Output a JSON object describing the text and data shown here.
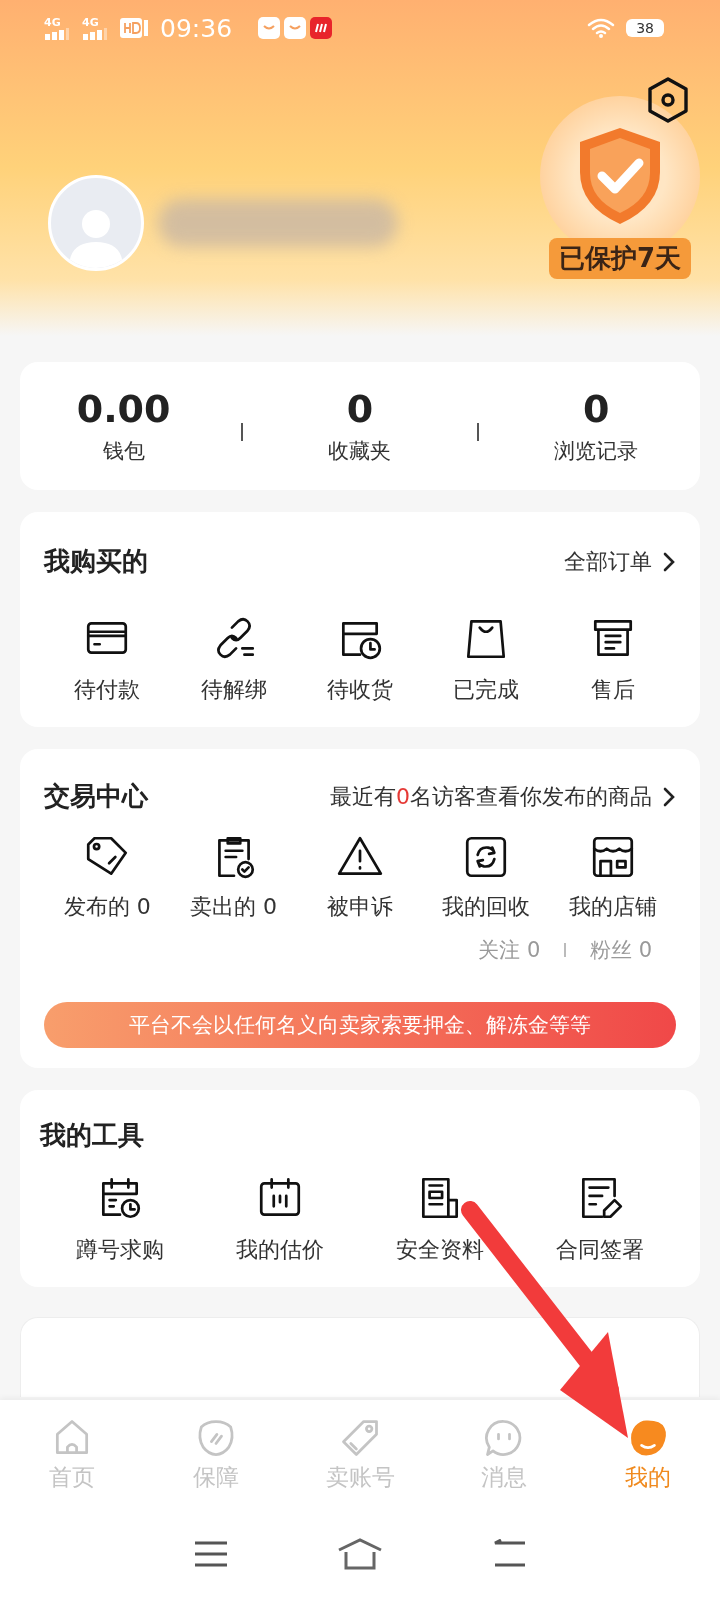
{
  "status_bar": {
    "signals": [
      "4G",
      "4G"
    ],
    "time": "09:36",
    "battery": "38"
  },
  "profile": {
    "protection_badge": "已保护7天"
  },
  "stats": [
    {
      "value": "0.00",
      "label": "钱包"
    },
    {
      "value": "0",
      "label": "收藏夹"
    },
    {
      "value": "0",
      "label": "浏览记录"
    }
  ],
  "purchases": {
    "title": "我购买的",
    "link": "全部订单",
    "items": [
      "待付款",
      "待解绑",
      "待收货",
      "已完成",
      "售后"
    ]
  },
  "trading": {
    "title": "交易中心",
    "notice_before": "最近有",
    "notice_count": "0",
    "notice_after": "名访客查看你发布的商品",
    "items": [
      "发布的 0",
      "卖出的 0",
      "被申诉",
      "我的回收",
      "我的店铺"
    ],
    "shop_stats": [
      "关注 0",
      "粉丝 0"
    ],
    "banner": "平台不会以任何名义向卖家索要押金、解冻金等等"
  },
  "tools": {
    "title": "我的工具",
    "items": [
      "蹲号求购",
      "我的估价",
      "安全资料",
      "合同签署"
    ]
  },
  "tab_bar": [
    {
      "label": "首页",
      "selected": false
    },
    {
      "label": "保障",
      "selected": false
    },
    {
      "label": "卖账号",
      "selected": false
    },
    {
      "label": "消息",
      "selected": false
    },
    {
      "label": "我的",
      "selected": true
    }
  ]
}
